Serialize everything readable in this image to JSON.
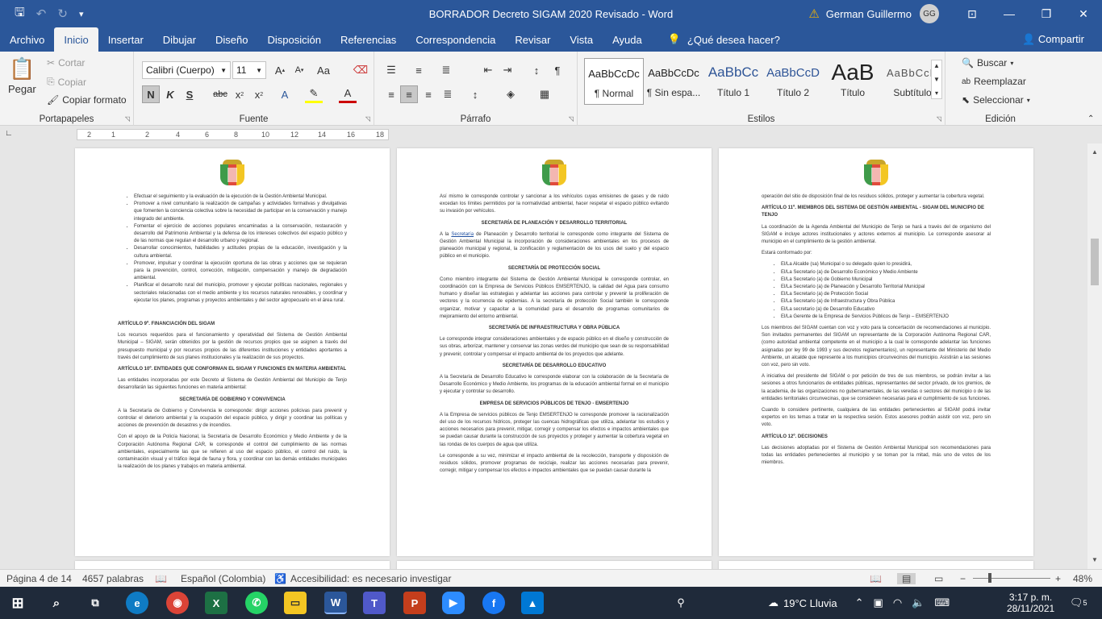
{
  "titlebar": {
    "title": "BORRADOR Decreto SIGAM 2020 Revisado  -  Word",
    "user": "German Guillermo",
    "initials": "GG",
    "save": "🖫",
    "undo": "↶",
    "redo": "↻",
    "customize": "▾",
    "minimize": "—",
    "restore": "❐",
    "close": "✕"
  },
  "menu": {
    "items": [
      "Archivo",
      "Inicio",
      "Insertar",
      "Dibujar",
      "Diseño",
      "Disposición",
      "Referencias",
      "Correspondencia",
      "Revisar",
      "Vista",
      "Ayuda"
    ],
    "tell": "¿Qué desea hacer?",
    "share": "Compartir"
  },
  "ribbon": {
    "clipboard": {
      "paste": "Pegar",
      "cut": "Cortar",
      "copy": "Copiar",
      "format_painter": "Copiar formato",
      "label": "Portapapeles"
    },
    "font": {
      "name": "Calibri (Cuerpo)",
      "size": "11",
      "label": "Fuente"
    },
    "paragraph": {
      "label": "Párrafo"
    },
    "styles": {
      "items": [
        {
          "preview": "AaBbCcDc",
          "name": "¶ Normal"
        },
        {
          "preview": "AaBbCcDc",
          "name": "¶ Sin espa..."
        },
        {
          "preview": "AaBbCc",
          "name": "Título 1"
        },
        {
          "preview": "AaBbCcD",
          "name": "Título 2"
        },
        {
          "preview": "AaB",
          "name": "Título"
        },
        {
          "preview": "AaBbCcD",
          "name": "Subtítulo"
        }
      ],
      "label": "Estilos"
    },
    "editing": {
      "find": "Buscar",
      "replace": "Reemplazar",
      "select": "Seleccionar",
      "label": "Edición"
    }
  },
  "ruler": {
    "ticks": [
      "2",
      "1",
      "2",
      "4",
      "6",
      "8",
      "10",
      "12",
      "14",
      "16",
      "18"
    ]
  },
  "pages": [
    {
      "bullets": [
        "Efectuar el seguimiento y la evaluación de la ejecución de la Gestión Ambiental Municipal.",
        "Promover a nivel comunitario la realización de campañas y actividades formativas y divulgativas que fomenten la conciencia colectiva sobre la necesidad de participar en la conservación y manejo integrado del ambiente.",
        "Fomentar el ejercicio de acciones populares encaminadas a la conservación, restauración y desarrollo del Patrimonio Ambiental y la defensa de los intereses colectivos del espacio público y de las normas que regulan el desarrollo urbano y regional.",
        "Desarrollar conocimientos, habilidades y actitudes propias de la educación, investigación y la cultura ambiental.",
        "Promover, impulsar y coordinar la ejecución oportuna de las obras y acciones que se requieran para la prevención, control, corrección, mitigación, compensación y manejo de degradación ambiental.",
        "Planificar el desarrollo rural del municipio, promover y ejecutar políticas nacionales, regionales y sectoriales relacionadas con el medio ambiente y los recursos naturales renovables, y coordinar y ejecutar los planes, programas y proyectos ambientales y del sector agropecuario en el área rural."
      ],
      "h1": "ARTÍCULO 9º. FINANCIACIÓN DEL SIGAM",
      "p1": "Los recursos requeridos para el funcionamiento y operatividad del Sistema de Gestión Ambiental Municipal – SIGAM, serán obtenidos por la gestión de recursos propios que se asignen a través del presupuesto municipal y por recursos propios de las diferentes instituciones y entidades aportantes a través del cumplimiento de sus planes institucionales y la realización de sus proyectos.",
      "h2": "ARTÍCULO 10º. ENTIDADES QUE CONFORMAN EL SIGAM Y FUNCIONES EN MATERIA AMBIENTAL",
      "p2": "Las entidades incorporadas por este Decreto al Sistema de Gestión Ambiental del Municipio de Tenjo desarrollarán las siguientes funciones en materia ambiental:",
      "h3": "SECRETARÍA DE GOBIERNO Y CONVIVENCIA",
      "p3": "A la Secretaría de Gobierno y Convivencia le corresponde: dirigir acciones policivas para prevenir y controlar el deterioro ambiental y la ocupación del espacio público, y dirigir y coordinar las políticas y acciones de prevención de desastres y de incendios.",
      "p4": "Con el apoyo de la Policía Nacional, la Secretaría de Desarrollo Económico y Medio Ambiente y de la Corporación Autónoma Regional CAR, le corresponde el control del cumplimiento de las normas ambientales, especialmente las que se refieren al uso del espacio público, el control del ruido, la contaminación visual y el tráfico ilegal de fauna y flora, y coordinar con las demás entidades municipales la realización de los planes y trabajos en materia ambiental."
    },
    {
      "p0": "Así mismo le corresponde controlar y sancionar a los vehículos cuyas emisiones de gases y de ruido excedan los límites permitidos por la normatividad ambiental, hacer respetar el espacio público evitando su invasión por vehículos.",
      "h1": "SECRETARÍA DE PLANEACIÓN Y DESARROLLO TERRITORIAL",
      "p1a": "A la ",
      "p1link": "Secretaría",
      "p1b": " de Planeación y Desarrollo territorial le corresponde como integrante del Sistema de Gestión Ambiental Municipal la incorporación de consideraciones ambientales en los procesos de planeación municipal y regional, la zonificación y reglamentación de los usos del suelo y del espacio público en el municipio.",
      "h2": "SECRETARÍA DE PROTECCIÓN SOCIAL",
      "p2": "Como miembro integrante del Sistema de Gestión Ambiental Municipal le corresponde controlar, en coordinación con la Empresa de Servicios Públicos EMSERTENJO, la calidad del Agua para consumo humano y diseñar las estrategias y adelantar las acciones para controlar y prevenir la proliferación de vectores y la ocurrencia de epidemias. A la secretaría de protección Social también le corresponde organizar, motivar y capacitar a la comunidad para el desarrollo de programas comunitarios de mejoramiento del entorno ambiental.",
      "h3": "SECRETARÍA DE INFRAESTRUCTURA Y OBRA PÚBLICA",
      "p3": "Le corresponde integrar consideraciones ambientales y de espacio público en el diseño y construcción de sus obras, arborizar, mantener y conservar las zonas verdes del municipio que sean de su responsabilidad y prevenir, controlar y compensar el impacto ambiental de los proyectos que adelante.",
      "h4": "SECRETARÍA DE DESARROLLO EDUCATIVO",
      "p4": "A la Secretaría de Desarrollo Educativo le corresponde elaborar con la colaboración de la Secretaría de Desarrollo Económico y Medio Ambiente, los programas de la educación ambiental formal en el municipio y ejecutar y controlar su desarrollo.",
      "h5": "EMPRESA DE SERVICIOS PÚBLICOS DE TENJO - EMSERTENJO",
      "p5": "A la Empresa de servicios públicos de Tenjo EMSERTENJO le corresponde promover la racionalización del uso de los recursos hídricos, proteger las cuencas hidrográficas que utiliza, adelantar los estudios y acciones necesarios para prevenir, mitigar, corregir y compensar los efectos e impactos ambientales que se puedan causar durante la construcción de sus proyectos y proteger y aumentar la cobertura vegetal en las rondas de los cuerpos de agua que utiliza.",
      "p6": "Le corresponde a su vez, minimizar el impacto ambiental de la recolección, transporte y disposición de residuos sólidos, promover programas de reciclaje, realizar las acciones necesarias para prevenir, corregir, mitigar y compensar los efectos e impactos ambientales que se puedan causar durante la"
    },
    {
      "p0": "operación del sitio de disposición final de los residuos sólidos, proteger y aumentar la cobertura vegetal.",
      "h1": "ARTÍCULO 11º. MIEMBROS DEL SISTEMA DE GESTIÓN AMBIENTAL - SIGAM DEL MUNICIPIO DE TENJO",
      "p1": "La coordinación de la Agenda Ambiental del Municipio de Tenjo se hará a través del de organismo del SIGAM e incluye actores institucionales y actores externos al municipio. Le corresponde asesorar al municipio en el cumplimiento de la gestión ambiental.",
      "p2": "Estará conformado por:",
      "members": [
        "El/La Alcalde (sa) Municipal o su delegado quien lo presidirá,",
        "El/La Secretario (a) de Desarrollo Económico y Medio Ambiente",
        "El/La Secretario (a) de Gobierno Municipal",
        "El/La Secretario (a) de Planeación y Desarrollo Territorial Municipal",
        "El/La Secretario (a) de Protección Social",
        "El/La Secretario (a) de Infraestructura y Obra Pública",
        "El/La secretario (a) de Desarrollo Educativo",
        "El/La Gerente de la Empresa de Servicios Públicos de Tenjo – EMSERTENJO"
      ],
      "p3": "Los miembros del SIGAM cuentan con voz y voto para la concertación de recomendaciones al municipio. Son invitados permanentes del SIGAM un representante de la Corporación Autónoma Regional CAR, (como autoridad ambiental competente en el municipio a la cual le corresponde adelantar las funciones asignadas por ley 99 de 1993 y sus decretos reglamentarios), un representante del Ministerio del Medio Ambiente, un alcalde que represente a los municipios circunvecinos del municipio. Asistirán a las sesiones con voz, pero sin voto.",
      "p4": "A iniciativa del presidente del SIGAM o por petición de tres de sus miembros, se podrán invitar a las sesiones a otros funcionarios de entidades públicas, representantes del sector privado, de los gremios, de la academia, de las organizaciones no gubernamentales, de las veredas o sectores del municipio o de las entidades territoriales circunvecinas, que se consideren necesarias para el cumplimiento de sus funciones.",
      "p5": "Cuando lo considere pertinente, cualquiera de las entidades pertenecientes al SIGAM podrá invitar expertos en los temas a tratar en la respectiva sesión. Estos asesores podrán asistir con voz, pero sin voto.",
      "h2": "ARTÍCULO 12º. DECISIONES",
      "p6": "Las decisiones adoptadas por el Sistema de Gestión Ambiental Municipal son recomendaciones para todas las entidades pertenecientes al municipio y se toman por la mitad, más uno de votos de los miembros."
    }
  ],
  "status": {
    "page": "Página 4 de 14",
    "words": "4657 palabras",
    "language": "Español (Colombia)",
    "accessibility": "Accesibilidad: es necesario investigar",
    "zoom": "48%",
    "zoom_level": 0.48
  },
  "taskbar": {
    "weather": "19°C  Lluvia",
    "time": "3:17 p. m.",
    "date": "28/11/2021",
    "notifications": "5"
  }
}
